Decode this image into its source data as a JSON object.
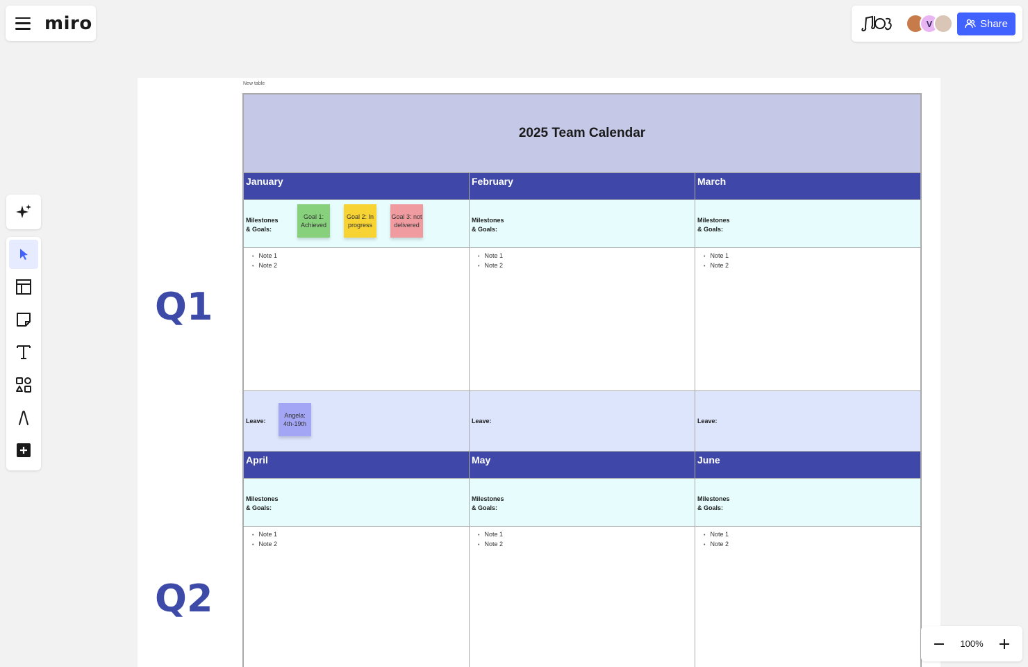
{
  "brand": {
    "logo": "miro"
  },
  "header": {
    "share_label": "Share",
    "avatar_initial": "V"
  },
  "zoom": {
    "level": "100%"
  },
  "board": {
    "table_label": "New table",
    "title": "2025 Team Calendar",
    "quarters": [
      "Q1",
      "Q2"
    ],
    "goals_label_line1": "Milestones",
    "goals_label_line2": "& Goals:",
    "leave_label": "Leave:",
    "months": [
      "January",
      "February",
      "March",
      "April",
      "May",
      "June"
    ],
    "notes": [
      "Note 1",
      "Note 2"
    ],
    "stickies": {
      "goal1": "Goal 1: Achieved",
      "goal2": "Goal 2: In progress",
      "goal3": "Goal 3: not delivered",
      "leave": "Angela: 4th-19th"
    }
  },
  "colors": {
    "accent": "#4262ff",
    "month_header": "#3f48a8",
    "title_bg": "#c5c8e6",
    "goals_bg": "#e7fdfd",
    "leave_bg": "#dde5fd",
    "quarter_text": "#3d4aa8"
  },
  "icons": {
    "menu": "hamburger-icon",
    "reactions": "reactions-icon",
    "share": "users-icon",
    "ai": "sparkle-icon",
    "select": "cursor-icon",
    "templates": "templates-icon",
    "sticky": "sticky-note-icon",
    "text": "text-icon",
    "shapes": "shapes-icon",
    "pen": "pen-icon",
    "more": "plus-square-icon",
    "zoom_out": "minus-icon",
    "zoom_in": "plus-icon"
  }
}
